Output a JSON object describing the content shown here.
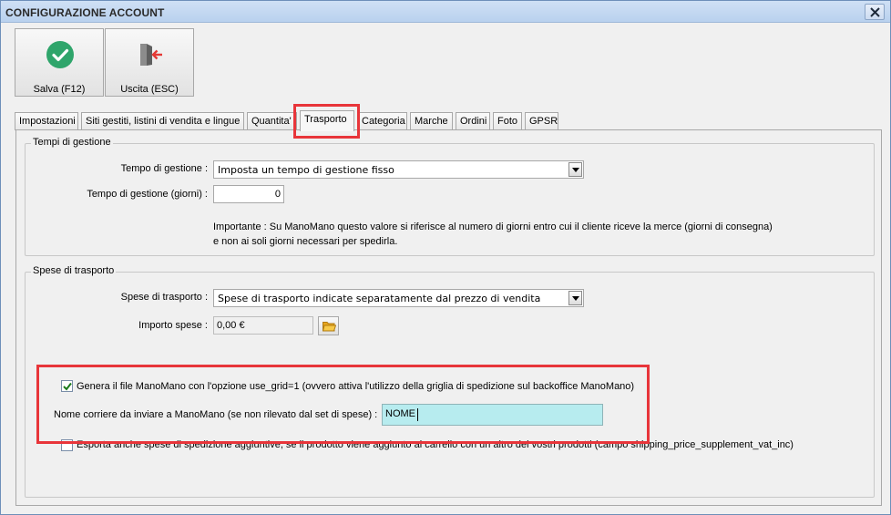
{
  "window": {
    "title": "CONFIGURAZIONE ACCOUNT"
  },
  "toolbar": {
    "save": {
      "label": "Salva (F12)",
      "icon": "check-circle-icon",
      "color": "#2fa56b"
    },
    "exit": {
      "label": "Uscita (ESC)",
      "icon": "exit-door-icon",
      "color": "#e53935"
    }
  },
  "tabs": [
    {
      "label": "Impostazioni"
    },
    {
      "label": "Siti gestiti, listini di vendita e lingue"
    },
    {
      "label": "Quantita'"
    },
    {
      "label": "Trasporto",
      "active": true
    },
    {
      "label": "Categoria"
    },
    {
      "label": "Marche"
    },
    {
      "label": "Ordini"
    },
    {
      "label": "Foto"
    },
    {
      "label": "GPSR"
    }
  ],
  "tempi": {
    "legend": "Tempi di gestione",
    "tempo_label": "Tempo di gestione :",
    "tempo_value": "Imposta un tempo di gestione fisso",
    "giorni_label": "Tempo di gestione (giorni) :",
    "giorni_value": "0",
    "note_line1": "Importante : Su ManoMano questo valore si riferisce al numero di giorni entro cui il cliente riceve la merce (giorni di consegna)",
    "note_line2": "e non ai soli giorni necessari per spedirla."
  },
  "spese": {
    "legend": "Spese di trasporto",
    "spese_label": "Spese di trasporto :",
    "spese_value": "Spese di trasporto indicate separatamente dal prezzo di vendita",
    "importo_label": "Importo spese :",
    "importo_value": "0,00 €",
    "use_grid_label": "Genera il file ManoMano con l'opzione use_grid=1 (ovvero attiva l'utilizzo della griglia di spedizione sul backoffice ManoMano)",
    "use_grid_checked": true,
    "corriere_label": "Nome corriere da inviare a ManoMano (se non rilevato dal set di spese) :",
    "corriere_value": "NOME",
    "supplement_label": "Esporta anche spese di spedizione aggiuntive, se il prodotto viene aggiunto al carrello con un altro dei vostri prodotti (campo shipping_price_supplement_vat_inc)",
    "supplement_checked": false
  },
  "colors": {
    "highlight": "#e8353a",
    "nome_field_bg": "#b7ecef",
    "titlebar": "#c4d8f2"
  }
}
